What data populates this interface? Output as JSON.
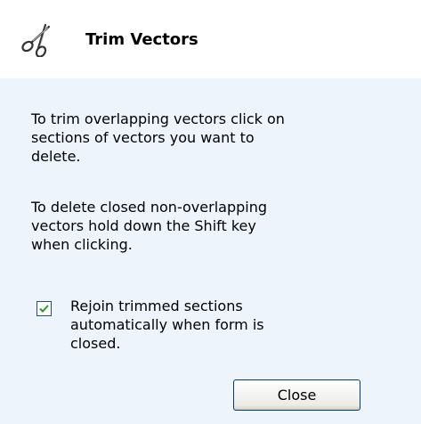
{
  "header": {
    "title": "Trim Vectors",
    "icon": "scissors-icon"
  },
  "instructions": {
    "paragraph1": "To trim overlapping vectors click on sections of vectors you want to delete.",
    "paragraph2": "To delete closed non-overlapping vectors hold down the Shift key when clicking."
  },
  "options": {
    "rejoin_label": "Rejoin trimmed sections automatically when form is closed.",
    "rejoin_checked": true
  },
  "actions": {
    "close_label": "Close"
  },
  "colors": {
    "body_background": "#eef4fc",
    "checkbox_check": "#2a9a2a",
    "button_border": "#003c74"
  }
}
